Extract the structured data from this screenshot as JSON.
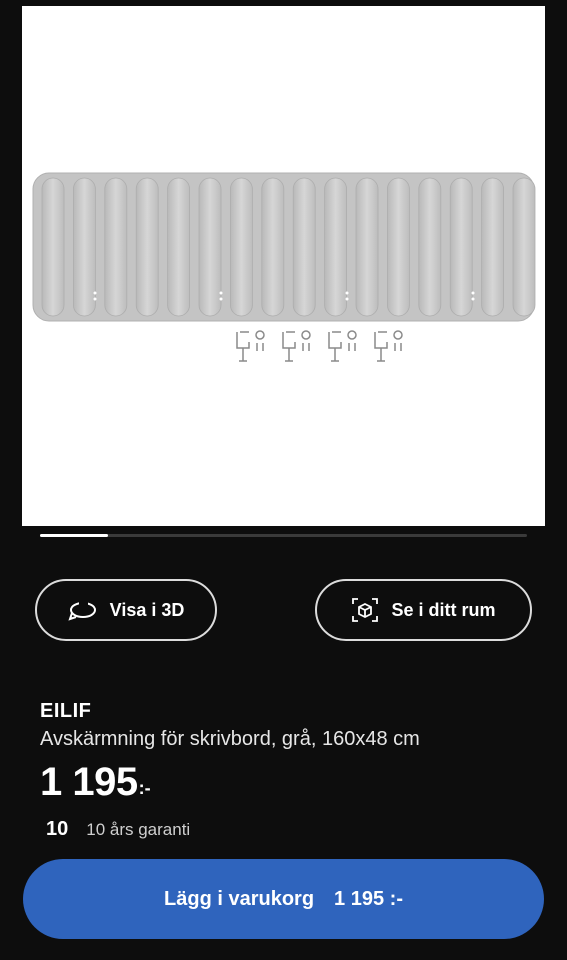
{
  "gallery": {
    "image_alt_icon": "desk-screen-product-image",
    "progress_fraction": 0.14
  },
  "actions": {
    "view_3d_label": "Visa i 3D",
    "view_3d_icon": "rotate-3d-icon",
    "ar_label": "Se i ditt rum",
    "ar_icon": "ar-cube-icon"
  },
  "product": {
    "name": "EILIF",
    "description": "Avskärmning för skrivbord, grå, 160x48 cm",
    "price": "1 195",
    "price_suffix": ":-"
  },
  "warranty": {
    "years": "10",
    "label": "10 års garanti"
  },
  "cart": {
    "label": "Lägg i varukorg",
    "price": "1 195 :-"
  },
  "colors": {
    "background": "#0d0d0d",
    "accent_blue": "#2f64bd",
    "panel_gray": "#cfcfcf"
  }
}
